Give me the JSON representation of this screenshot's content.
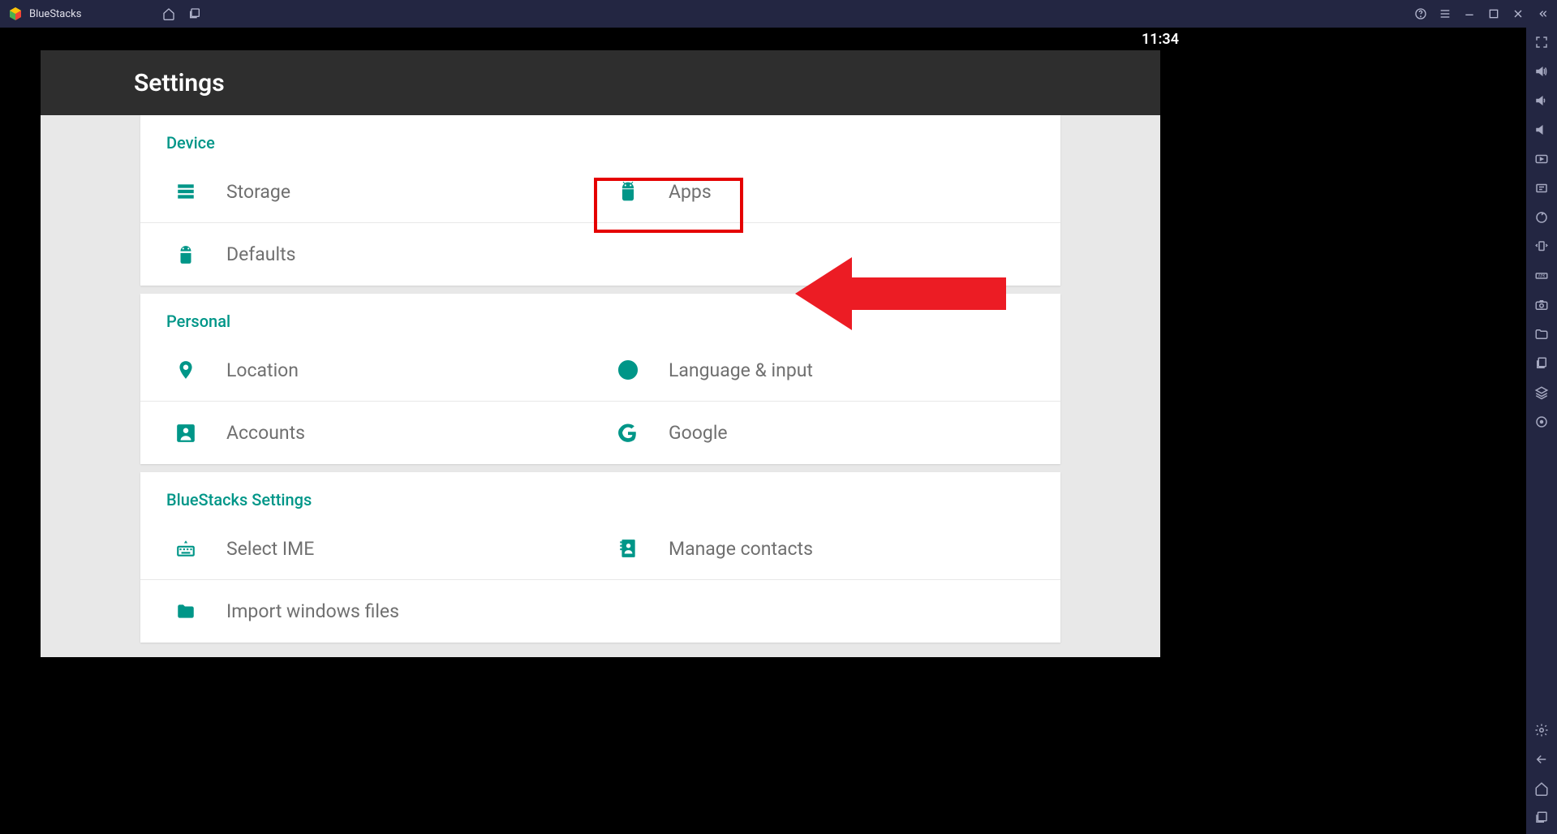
{
  "titlebar": {
    "app_name": "BlueStacks"
  },
  "status": {
    "time": "11:34"
  },
  "header": {
    "title": "Settings"
  },
  "sections": [
    {
      "title": "Device",
      "items": [
        {
          "label": "Storage",
          "icon": "storage-icon"
        },
        {
          "label": "Apps",
          "icon": "android-icon",
          "highlighted": true
        },
        {
          "label": "Defaults",
          "icon": "android-icon"
        }
      ]
    },
    {
      "title": "Personal",
      "items": [
        {
          "label": "Location",
          "icon": "location-icon"
        },
        {
          "label": "Language & input",
          "icon": "globe-icon"
        },
        {
          "label": "Accounts",
          "icon": "account-icon"
        },
        {
          "label": "Google",
          "icon": "google-icon"
        }
      ]
    },
    {
      "title": "BlueStacks Settings",
      "items": [
        {
          "label": "Select IME",
          "icon": "keyboard-icon"
        },
        {
          "label": "Manage contacts",
          "icon": "contacts-icon"
        },
        {
          "label": "Import windows files",
          "icon": "folder-icon"
        }
      ]
    }
  ]
}
